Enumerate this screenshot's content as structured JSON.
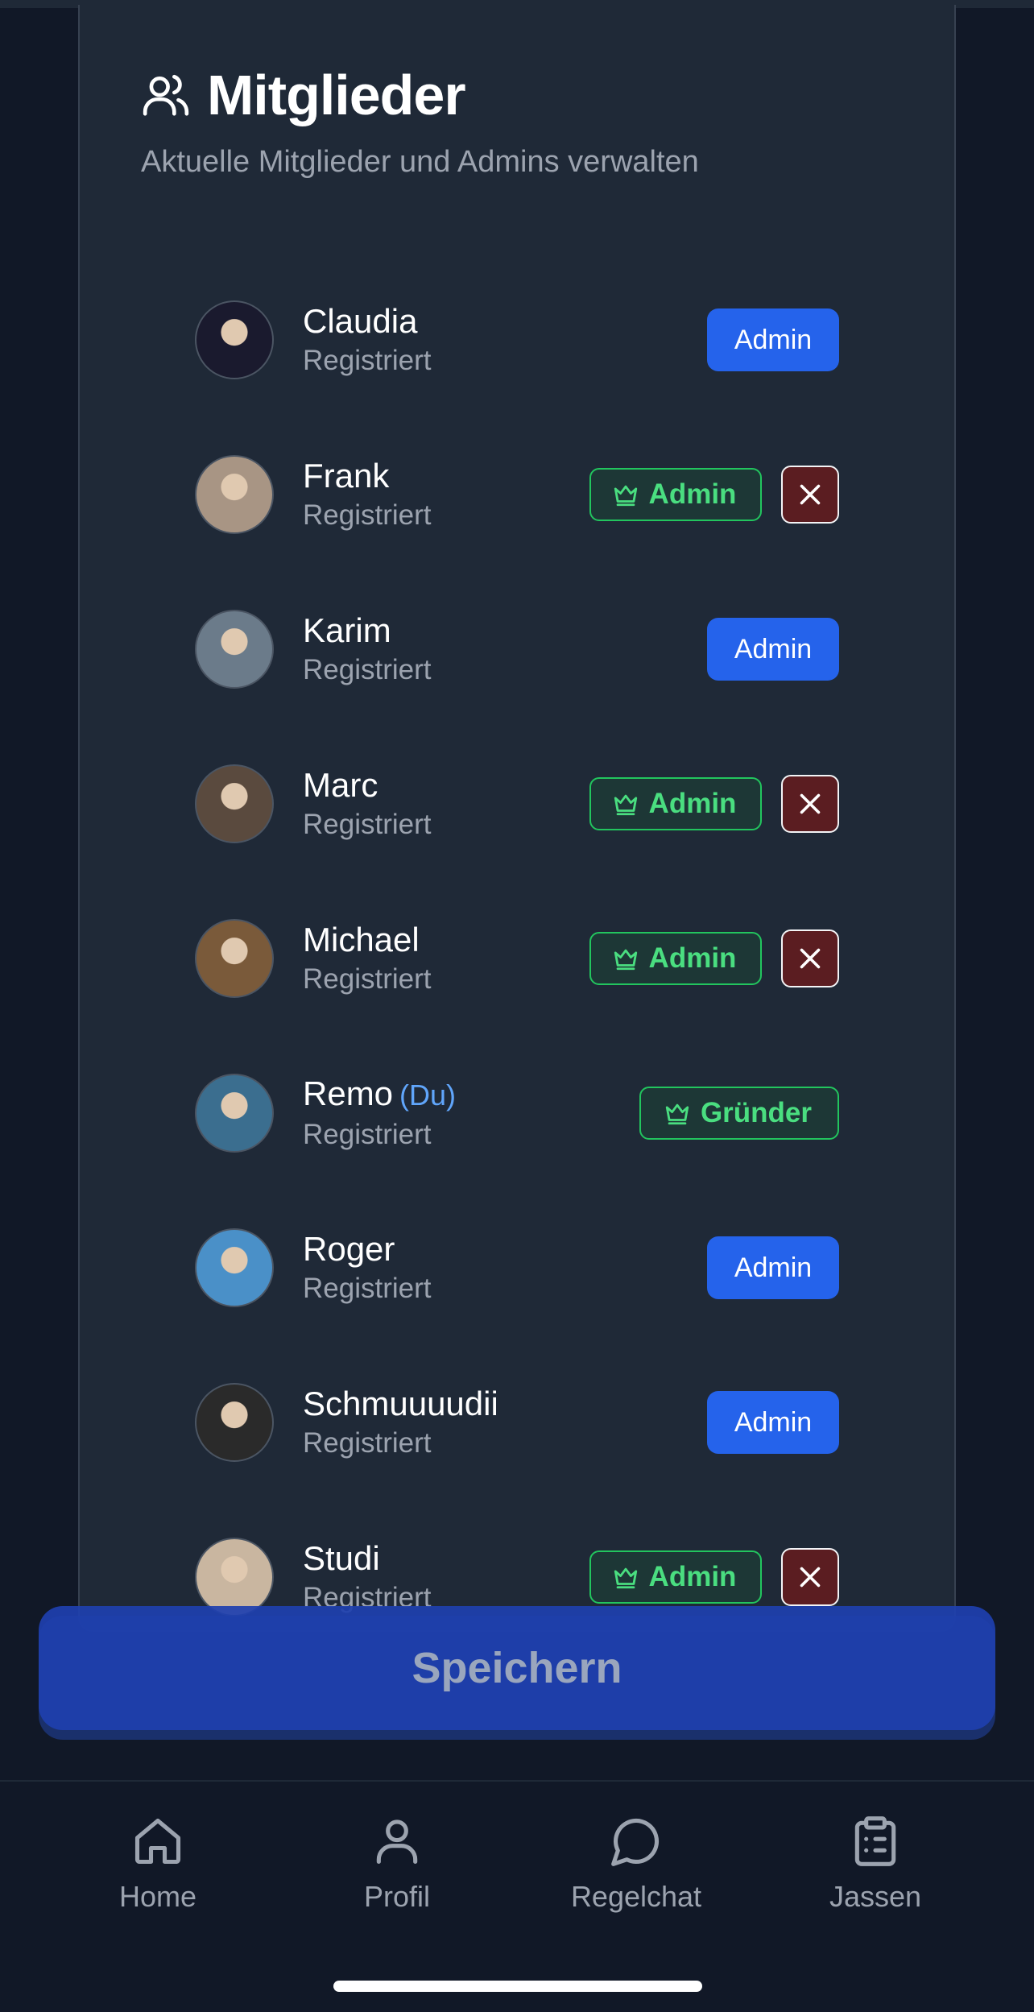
{
  "section": {
    "title": "Mitglieder",
    "subtitle": "Aktuelle Mitglieder und Admins verwalten",
    "icon": "users-icon"
  },
  "members": [
    {
      "name": "Claudia",
      "you_tag": "",
      "status": "Registriert",
      "role": "member",
      "action_label": "Admin",
      "avatar_color": "#1a1a2e"
    },
    {
      "name": "Frank",
      "you_tag": "",
      "status": "Registriert",
      "role": "admin",
      "action_label": "Admin",
      "avatar_color": "#a89584"
    },
    {
      "name": "Karim",
      "you_tag": "",
      "status": "Registriert",
      "role": "member",
      "action_label": "Admin",
      "avatar_color": "#6b7b8a"
    },
    {
      "name": "Marc",
      "you_tag": "",
      "status": "Registriert",
      "role": "admin",
      "action_label": "Admin",
      "avatar_color": "#5a4a3e"
    },
    {
      "name": "Michael",
      "you_tag": "",
      "status": "Registriert",
      "role": "admin",
      "action_label": "Admin",
      "avatar_color": "#7a5a3a"
    },
    {
      "name": "Remo",
      "you_tag": "(Du)",
      "status": "Registriert",
      "role": "founder",
      "action_label": "Gründer",
      "avatar_color": "#3b6e8f"
    },
    {
      "name": "Roger",
      "you_tag": "",
      "status": "Registriert",
      "role": "member",
      "action_label": "Admin",
      "avatar_color": "#4a90c8"
    },
    {
      "name": "Schmuuuudii",
      "you_tag": "",
      "status": "Registriert",
      "role": "member",
      "action_label": "Admin",
      "avatar_color": "#2a2a2a"
    },
    {
      "name": "Studi",
      "you_tag": "",
      "status": "Registriert",
      "role": "admin",
      "action_label": "Admin",
      "avatar_color": "#c9b6a0"
    }
  ],
  "save_button": {
    "label": "Speichern"
  },
  "nav": [
    {
      "label": "Home",
      "icon": "home-icon"
    },
    {
      "label": "Profil",
      "icon": "user-icon"
    },
    {
      "label": "Regelchat",
      "icon": "chat-bubble-icon"
    },
    {
      "label": "Jassen",
      "icon": "clipboard-list-icon"
    }
  ],
  "colors": {
    "background": "#111827",
    "card": "#1f2937",
    "primary": "#2563eb",
    "success": "#4ade80",
    "danger": "#5b1d21",
    "muted": "#9ca3af",
    "you_tag": "#60a5fa"
  }
}
